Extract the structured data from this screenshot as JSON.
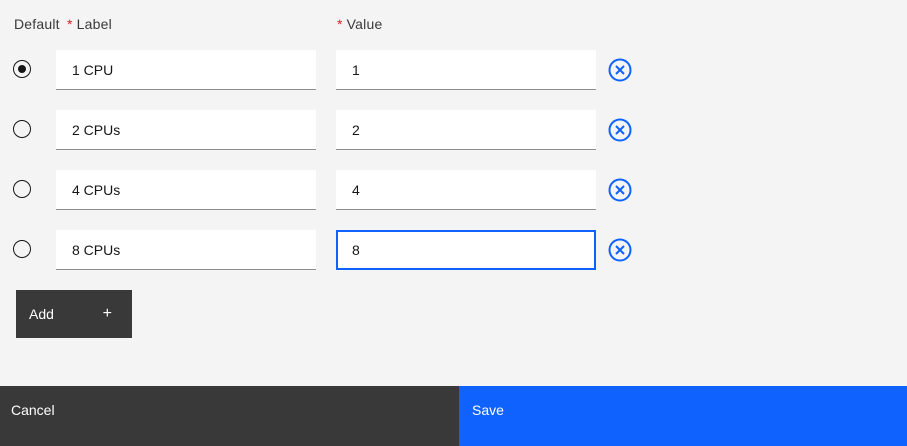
{
  "headers": {
    "default": "Default",
    "label": "Label",
    "value": "Value",
    "required_marker": "*"
  },
  "rows": [
    {
      "label": "1 CPU",
      "value": "1",
      "default": true
    },
    {
      "label": "2 CPUs",
      "value": "2",
      "default": false
    },
    {
      "label": "4 CPUs",
      "value": "4",
      "default": false
    },
    {
      "label": "8 CPUs",
      "value": "8",
      "default": false,
      "focused": true
    }
  ],
  "add_button": {
    "label": "Add",
    "icon": "plus-icon"
  },
  "footer": {
    "cancel_label": "Cancel",
    "save_label": "Save"
  },
  "colors": {
    "accent": "#0f62fe",
    "required": "#da1e28",
    "dark_button": "#393939"
  }
}
